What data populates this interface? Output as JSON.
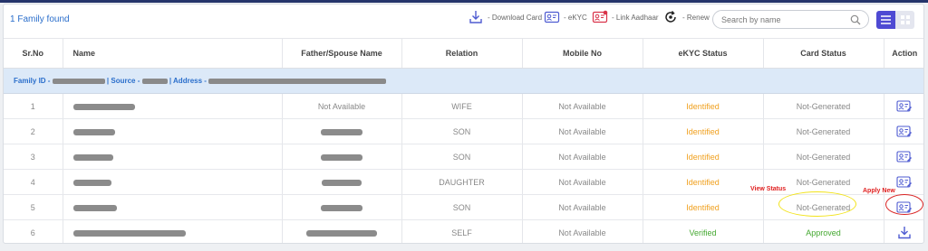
{
  "found_text": "1 Family found",
  "legend": [
    {
      "icon": "download-icon",
      "label": "- Download Card"
    },
    {
      "icon": "ekyc-card-icon",
      "label": "- eKYC"
    },
    {
      "icon": "link-aadhaar-icon",
      "label": "- Link Aadhaar"
    },
    {
      "icon": "renew-icon",
      "label": "- Renew"
    }
  ],
  "search": {
    "placeholder": "Search by name",
    "value": ""
  },
  "columns": [
    "Sr.No",
    "Name",
    "Father/Spouse Name",
    "Relation",
    "Mobile No",
    "eKYC Status",
    "Card Status",
    "Action"
  ],
  "family": {
    "id_label": "Family ID - ",
    "source_label": "| Source - ",
    "address_label": "| Address - "
  },
  "rows": [
    {
      "sr": "1",
      "father": "Not Available",
      "relation": "WIFE",
      "mobile": "Not Available",
      "ekyc": "Identified",
      "card": "Not-Generated",
      "action": "ekyc-card-icon"
    },
    {
      "sr": "2",
      "father": "",
      "relation": "SON",
      "mobile": "Not Available",
      "ekyc": "Identified",
      "card": "Not-Generated",
      "action": "ekyc-card-icon"
    },
    {
      "sr": "3",
      "father": "",
      "relation": "SON",
      "mobile": "Not Available",
      "ekyc": "Identified",
      "card": "Not-Generated",
      "action": "ekyc-card-icon"
    },
    {
      "sr": "4",
      "father": "",
      "relation": "DAUGHTER",
      "mobile": "Not Available",
      "ekyc": "Identified",
      "card": "Not-Generated",
      "action": "ekyc-card-icon"
    },
    {
      "sr": "5",
      "father": "",
      "relation": "SON",
      "mobile": "Not Available",
      "ekyc": "Identified",
      "card": "Not-Generated",
      "action": "ekyc-card-icon"
    },
    {
      "sr": "6",
      "father": "",
      "relation": "SELF",
      "mobile": "Not Available",
      "ekyc": "Verified",
      "card": "Approved",
      "action": "download-icon"
    }
  ],
  "annotations": {
    "view_status": "View Status",
    "apply_new": "Apply New"
  },
  "colors": {
    "accent": "#2a6ecb",
    "identified": "#f0a01e",
    "verified": "#44a830",
    "toggle": "#4e4ad3",
    "annotation_red": "#e02020",
    "annotation_yellow": "#f2e31a"
  }
}
